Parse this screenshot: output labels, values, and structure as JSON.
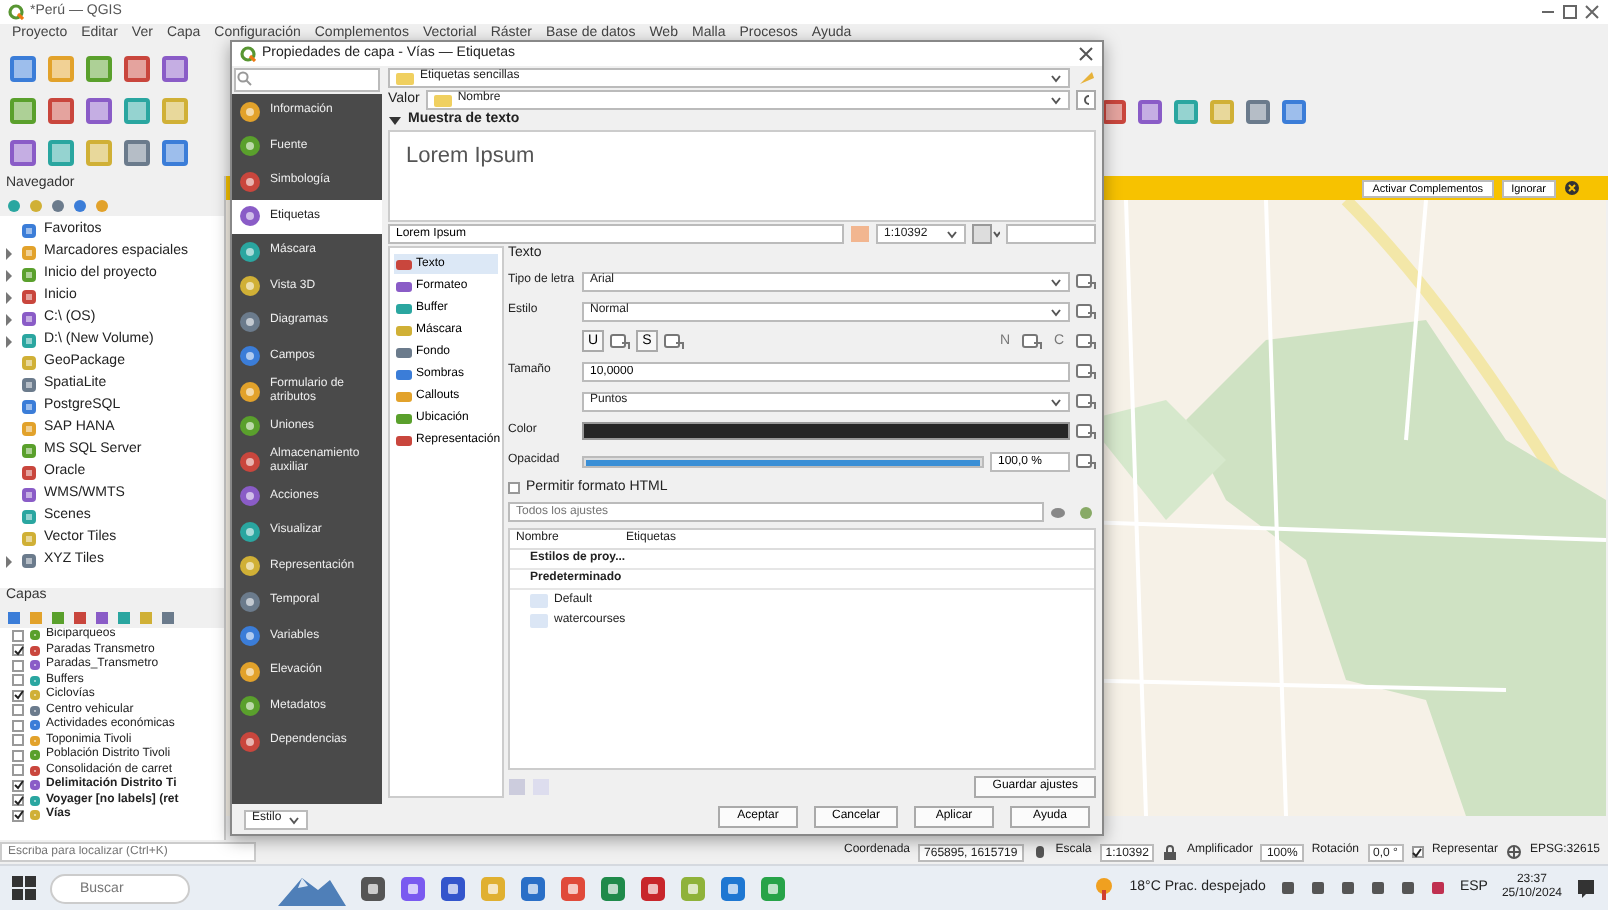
{
  "window": {
    "title": "*Perú — QGIS"
  },
  "menu": [
    "Proyecto",
    "Editar",
    "Ver",
    "Capa",
    "Configuración",
    "Complementos",
    "Vectorial",
    "Ráster",
    "Base de datos",
    "Web",
    "Malla",
    "Procesos",
    "Ayuda"
  ],
  "message_bar": {
    "buttons": [
      "Activar Complementos",
      "Ignorar"
    ]
  },
  "navigator": {
    "title": "Navegador",
    "items": [
      {
        "label": "Favoritos",
        "expandable": false
      },
      {
        "label": "Marcadores espaciales",
        "expandable": true
      },
      {
        "label": "Inicio del proyecto",
        "expandable": true
      },
      {
        "label": "Inicio",
        "expandable": true
      },
      {
        "label": "C:\\ (OS)",
        "expandable": true
      },
      {
        "label": "D:\\ (New Volume)",
        "expandable": true
      },
      {
        "label": "GeoPackage",
        "expandable": false
      },
      {
        "label": "SpatiaLite",
        "expandable": false
      },
      {
        "label": "PostgreSQL",
        "expandable": false
      },
      {
        "label": "SAP HANA",
        "expandable": false
      },
      {
        "label": "MS SQL Server",
        "expandable": false
      },
      {
        "label": "Oracle",
        "expandable": false
      },
      {
        "label": "WMS/WMTS",
        "expandable": false
      },
      {
        "label": "Scenes",
        "expandable": false
      },
      {
        "label": "Vector Tiles",
        "expandable": false
      },
      {
        "label": "XYZ Tiles",
        "expandable": true
      }
    ]
  },
  "layers": {
    "title": "Capas",
    "items": [
      {
        "label": "Biciparqueos",
        "checked": false,
        "emphasized": false
      },
      {
        "label": "Paradas Transmetro",
        "checked": true,
        "emphasized": false
      },
      {
        "label": "Paradas_Transmetro",
        "checked": false,
        "emphasized": false
      },
      {
        "label": "Buffers",
        "checked": false,
        "emphasized": false
      },
      {
        "label": "Ciclovías",
        "checked": true,
        "emphasized": false
      },
      {
        "label": "Centro vehicular",
        "checked": false,
        "emphasized": false
      },
      {
        "label": "Actividades económicas",
        "checked": false,
        "emphasized": false
      },
      {
        "label": "Toponimia Tivoli",
        "checked": false,
        "emphasized": false
      },
      {
        "label": "Población Distrito Tivoli",
        "checked": false,
        "emphasized": false
      },
      {
        "label": "Consolidación de carret",
        "checked": false,
        "emphasized": false
      },
      {
        "label": "Delimitación Distrito Ti",
        "checked": true,
        "emphasized": true
      },
      {
        "label": "Voyager [no labels] (ret",
        "checked": true,
        "emphasized": true
      },
      {
        "label": "Vías",
        "checked": true,
        "emphasized": true
      }
    ]
  },
  "locator": {
    "placeholder": "Escriba para localizar (Ctrl+K)"
  },
  "dialog": {
    "title": "Propiedades de capa - Vías — Etiquetas",
    "sidebar": [
      {
        "label": "Información",
        "selected": false
      },
      {
        "label": "Fuente",
        "selected": false
      },
      {
        "label": "Simbología",
        "selected": false
      },
      {
        "label": "Etiquetas",
        "selected": true
      },
      {
        "label": "Máscara",
        "selected": false
      },
      {
        "label": "Vista 3D",
        "selected": false
      },
      {
        "label": "Diagramas",
        "selected": false
      },
      {
        "label": "Campos",
        "selected": false
      },
      {
        "label": "Formulario de atributos",
        "selected": false
      },
      {
        "label": "Uniones",
        "selected": false
      },
      {
        "label": "Almacenamiento auxiliar",
        "selected": false
      },
      {
        "label": "Acciones",
        "selected": false
      },
      {
        "label": "Visualizar",
        "selected": false
      },
      {
        "label": "Representación",
        "selected": false
      },
      {
        "label": "Temporal",
        "selected": false
      },
      {
        "label": "Variables",
        "selected": false
      },
      {
        "label": "Elevación",
        "selected": false
      },
      {
        "label": "Metadatos",
        "selected": false
      },
      {
        "label": "Dependencias",
        "selected": false
      }
    ],
    "mode": "Etiquetas sencillas",
    "value_label": "Valor",
    "value": "Nombre",
    "sample": {
      "title": "Muestra de texto",
      "expanded": true,
      "preview": "Lorem Ipsum",
      "text": "Lorem Ipsum",
      "scale": "1:10392"
    },
    "tabs": [
      {
        "label": "Texto",
        "selected": true
      },
      {
        "label": "Formateo",
        "selected": false
      },
      {
        "label": "Buffer",
        "selected": false
      },
      {
        "label": "Máscara",
        "selected": false
      },
      {
        "label": "Fondo",
        "selected": false
      },
      {
        "label": "Sombras",
        "selected": false
      },
      {
        "label": "Callouts",
        "selected": false
      },
      {
        "label": "Ubicación",
        "selected": false
      },
      {
        "label": "Representación",
        "selected": false
      }
    ],
    "text_panel": {
      "heading": "Texto",
      "font": {
        "label": "Tipo de letra",
        "value": "Arial"
      },
      "style": {
        "label": "Estilo",
        "value": "Normal"
      },
      "left_buttons": [
        "U",
        "S"
      ],
      "right_buttons": [
        "N",
        "C"
      ],
      "size": {
        "label": "Tamaño",
        "value": "10,0000",
        "unit": "Puntos"
      },
      "color": {
        "label": "Color"
      },
      "opacity": {
        "label": "Opacidad",
        "level": 1,
        "reading": "100,0 %"
      },
      "allow_html": {
        "label": "Permitir formato HTML",
        "checked": false
      }
    },
    "style_search": {
      "placeholder": "Todos los ajustes"
    },
    "style_table": {
      "columns": [
        "Nombre",
        "Etiquetas"
      ],
      "rows": [
        {
          "label": "Estilos de proy...",
          "kind": "group"
        },
        {
          "label": "Predeterminado",
          "kind": "group"
        },
        {
          "label": "Default",
          "kind": "style"
        },
        {
          "label": "watercourses",
          "kind": "style"
        }
      ]
    },
    "save_button": "Guardar ajustes",
    "style_menu": "Estilo",
    "buttons": [
      "Aceptar",
      "Cancelar",
      "Aplicar",
      "Ayuda"
    ]
  },
  "status_bar": {
    "coordinate_label": "Coordenada",
    "coordinate": "765895, 1615719",
    "scale_label": "Escala",
    "scale": "1:10392",
    "magnifier_label": "Amplificador",
    "magnifier": "100%",
    "rotation_label": "Rotación",
    "rotation": "0,0 °",
    "render": {
      "label": "Representar",
      "checked": true
    },
    "crs": "EPSG:32615"
  },
  "taskbar": {
    "search_placeholder": "Buscar",
    "weather": "18°C Prac. despejado",
    "language": "ESP",
    "time": "23:37",
    "date": "25/10/2024"
  }
}
